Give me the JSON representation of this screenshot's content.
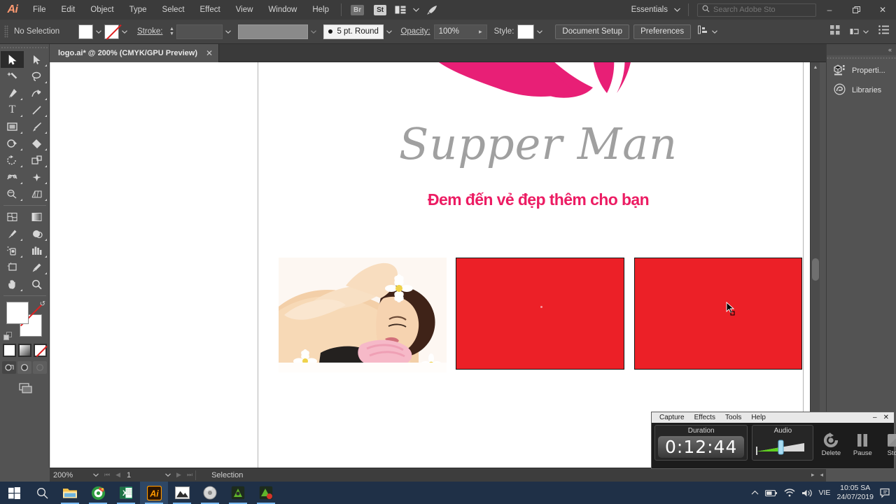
{
  "app": {
    "name": "Ai",
    "menus": [
      "File",
      "Edit",
      "Object",
      "Type",
      "Select",
      "Effect",
      "View",
      "Window",
      "Help"
    ],
    "bridge_badge": "Br",
    "stock_badge": "St",
    "workspace": "Essentials",
    "search_placeholder": "Search Adobe Sto",
    "window_buttons": {
      "minimize": "–",
      "restore": "❐",
      "close": "✕"
    }
  },
  "control_bar": {
    "selection_status": "No Selection",
    "stroke_label": "Stroke:",
    "stroke_weight": "",
    "brush_label": "5 pt. Round",
    "opacity_label": "Opacity:",
    "opacity_value": "100%",
    "style_label": "Style:",
    "document_setup": "Document Setup",
    "preferences": "Preferences"
  },
  "document_tab": {
    "title": "logo.ai* @ 200% (CMYK/GPU Preview)",
    "close": "✕"
  },
  "toolbar": {
    "tools": [
      {
        "name": "selection-tool",
        "glyph": "➤",
        "active": true
      },
      {
        "name": "direct-selection-tool",
        "glyph": "➤",
        "active": false
      },
      {
        "name": "magic-wand-tool",
        "glyph": "✦",
        "active": false
      },
      {
        "name": "lasso-tool",
        "glyph": "∴",
        "active": false
      },
      {
        "name": "pen-tool",
        "glyph": "✒",
        "active": false
      },
      {
        "name": "curvature-tool",
        "glyph": "∿",
        "active": false
      },
      {
        "name": "type-tool",
        "glyph": "T",
        "active": false
      },
      {
        "name": "line-segment-tool",
        "glyph": "╱",
        "active": false
      },
      {
        "name": "rectangle-tool",
        "glyph": "▭",
        "active": false
      },
      {
        "name": "paintbrush-tool",
        "glyph": "✐",
        "active": false
      },
      {
        "name": "shaper-tool",
        "glyph": "○",
        "active": false
      },
      {
        "name": "eraser-tool",
        "glyph": "◇",
        "active": false
      },
      {
        "name": "rotate-tool",
        "glyph": "↺",
        "active": false
      },
      {
        "name": "scale-tool",
        "glyph": "❐",
        "active": false
      },
      {
        "name": "width-tool",
        "glyph": "∞",
        "active": false
      },
      {
        "name": "free-transform-tool",
        "glyph": "✦",
        "active": false
      },
      {
        "name": "shape-builder-tool",
        "glyph": "◔",
        "active": false
      },
      {
        "name": "perspective-grid-tool",
        "glyph": "▦",
        "active": false
      },
      {
        "name": "mesh-tool",
        "glyph": "⊞",
        "active": false
      },
      {
        "name": "gradient-tool",
        "glyph": "▧",
        "active": false
      },
      {
        "name": "eyedropper-tool",
        "glyph": "⚗",
        "active": false
      },
      {
        "name": "blend-tool",
        "glyph": "◑",
        "active": false
      },
      {
        "name": "symbol-sprayer-tool",
        "glyph": "⁂",
        "active": false
      },
      {
        "name": "column-graph-tool",
        "glyph": "█",
        "active": false
      },
      {
        "name": "artboard-tool",
        "glyph": "⬚",
        "active": false
      },
      {
        "name": "slice-tool",
        "glyph": "✂",
        "active": false
      },
      {
        "name": "hand-tool",
        "glyph": "✋",
        "active": false
      },
      {
        "name": "zoom-tool",
        "glyph": "⚲",
        "active": false
      }
    ],
    "fill_color": "#ffffff",
    "stroke_color": "none",
    "paint_modes": [
      "color",
      "gradient",
      "none"
    ],
    "screen_modes": [
      "normal-screen-mode",
      "full-screen-menu-bar",
      "full-screen"
    ]
  },
  "artwork": {
    "brand_name": "Supper Man",
    "tagline": "Đem đến vẻ đẹp thêm cho bạn",
    "brand_color": "#a0a0a0",
    "tagline_color": "#ec1c63",
    "petal_color": "#e81f76",
    "box_fill": "#ec2027",
    "box_stroke": "#141414",
    "photo_alt": "spa-massage-photo"
  },
  "status_bar": {
    "zoom": "200%",
    "page": "1",
    "tool": "Selection"
  },
  "right_panel": {
    "collapse": "«",
    "items": [
      {
        "label": "Properti...",
        "icon": "properties-icon"
      },
      {
        "label": "Libraries",
        "icon": "creative-cloud-icon"
      }
    ]
  },
  "recorder": {
    "menus": [
      "Capture",
      "Effects",
      "Tools",
      "Help"
    ],
    "minimize": "–",
    "close": "✕",
    "duration_label": "Duration",
    "duration_value": "0:12:44",
    "audio_label": "Audio",
    "buttons": [
      {
        "label": "Delete",
        "icon": "delete-icon"
      },
      {
        "label": "Pause",
        "icon": "pause-icon"
      },
      {
        "label": "Stop",
        "icon": "stop-icon"
      }
    ]
  },
  "taskbar": {
    "items": [
      {
        "name": "start-button",
        "icon": "windows-logo-icon"
      },
      {
        "name": "search-button",
        "icon": "search-icon"
      },
      {
        "name": "file-explorer",
        "icon": "folder-icon"
      },
      {
        "name": "media-app",
        "icon": "disc-burner-icon"
      },
      {
        "name": "excel-app",
        "icon": "excel-icon"
      },
      {
        "name": "illustrator-app",
        "icon": "illustrator-icon"
      },
      {
        "name": "photos-app",
        "icon": "picture-icon"
      },
      {
        "name": "media-player",
        "icon": "gray-disc-icon"
      },
      {
        "name": "capture-app",
        "icon": "camtasia-icon"
      },
      {
        "name": "recorder-app",
        "icon": "recorder-icon"
      }
    ],
    "tray": {
      "language": "VIE",
      "time": "10:05 SA",
      "date": "24/07/2019",
      "icons": [
        "chevron-up-icon",
        "battery-icon",
        "wifi-icon",
        "volume-icon",
        "action-center-icon"
      ]
    }
  }
}
